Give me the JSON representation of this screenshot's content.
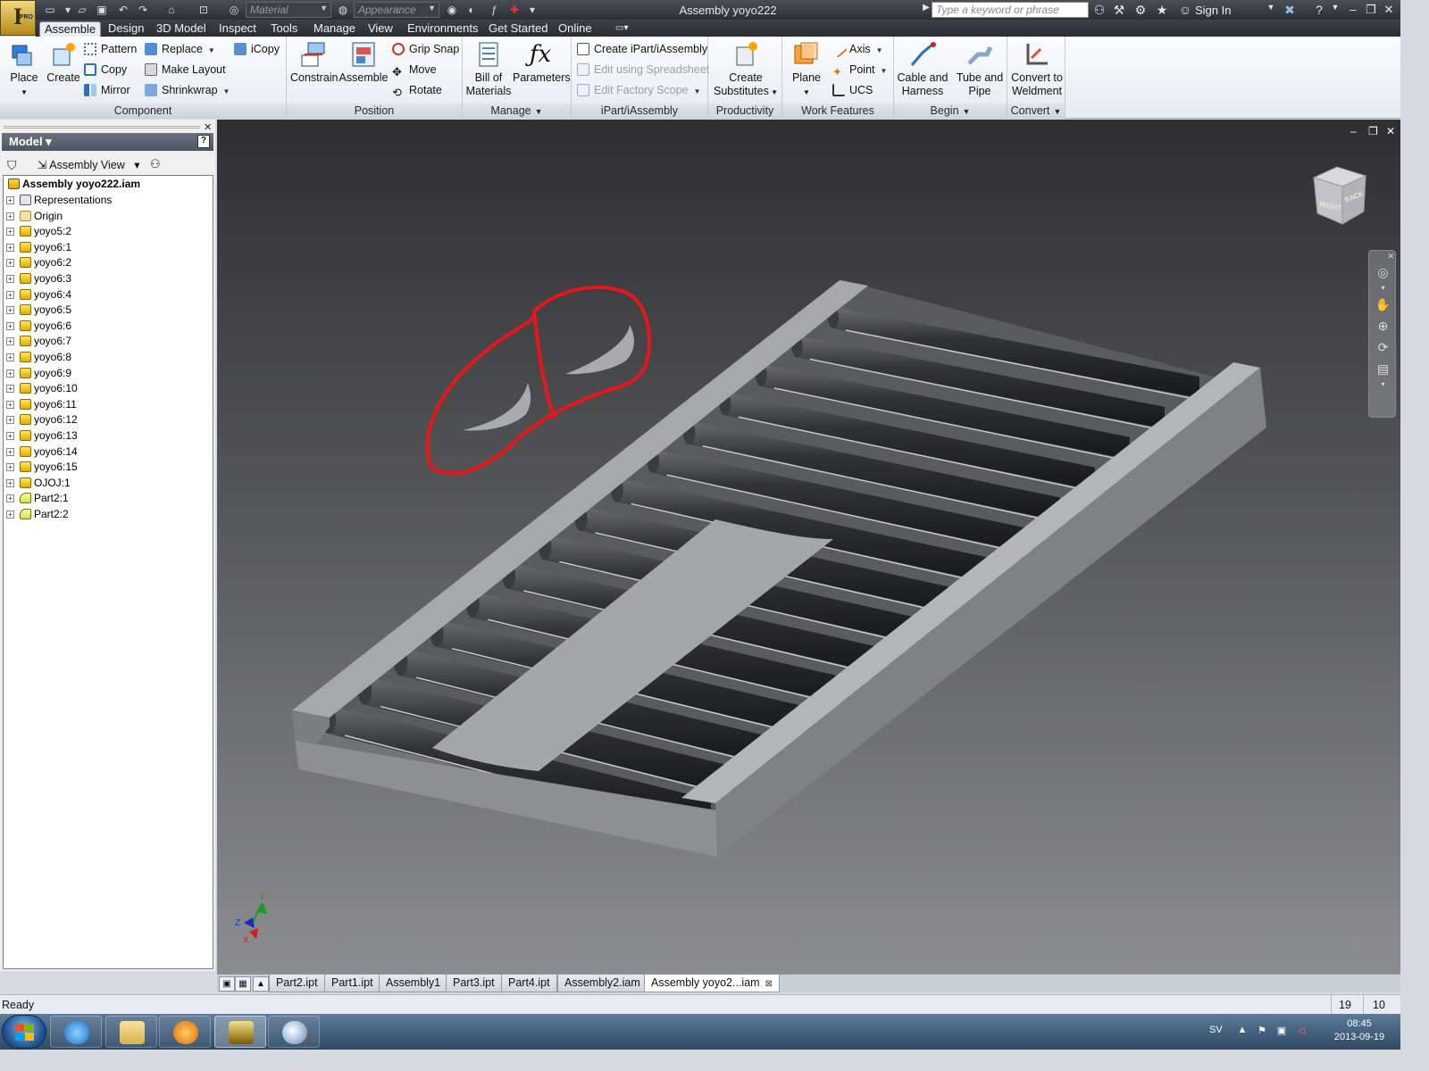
{
  "window": {
    "title": "Assembly yoyo222",
    "app_letter": "I",
    "app_badge": "PRO",
    "search_placeholder": "Type a keyword or phrase",
    "sign_in": "Sign In",
    "material_combo": "Material",
    "appearance_combo": "Appearance"
  },
  "menu_tabs": [
    "Assemble",
    "Design",
    "3D Model",
    "Inspect",
    "Tools",
    "Manage",
    "View",
    "Environments",
    "Get Started",
    "Online"
  ],
  "active_tab": "Assemble",
  "ribbon": {
    "component": {
      "title": "Component",
      "place": "Place",
      "create": "Create",
      "pattern": "Pattern",
      "copy": "Copy",
      "mirror": "Mirror",
      "replace": "Replace",
      "make_layout": "Make Layout",
      "shrinkwrap": "Shrinkwrap",
      "icopy": "iCopy"
    },
    "position": {
      "title": "Position",
      "constrain": "Constrain",
      "assemble": "Assemble",
      "grip_snap": "Grip Snap",
      "move": "Move",
      "rotate": "Rotate"
    },
    "manage": {
      "title": "Manage",
      "bom_line1": "Bill of",
      "bom_line2": "Materials",
      "parameters": "Parameters"
    },
    "ipart": {
      "title": "iPart/iAssembly",
      "create": "Create iPart/iAssembly",
      "edit_spreadsheet": "Edit using Spreadsheet",
      "edit_factory": "Edit Factory Scope"
    },
    "productivity": {
      "title": "Productivity",
      "line1": "Create",
      "line2": "Substitutes"
    },
    "work_features": {
      "title": "Work Features",
      "plane": "Plane",
      "axis": "Axis",
      "point": "Point",
      "ucs": "UCS"
    },
    "begin": {
      "title": "Begin",
      "cable_line1": "Cable and",
      "cable_line2": "Harness",
      "tube_line1": "Tube and",
      "tube_line2": "Pipe"
    },
    "convert": {
      "title": "Convert",
      "line1": "Convert to",
      "line2": "Weldment"
    }
  },
  "browser": {
    "title": "Model",
    "view": "Assembly View",
    "root": "Assembly yoyo222.iam",
    "nodes": [
      {
        "label": "Representations",
        "kind": "rep"
      },
      {
        "label": "Origin",
        "kind": "folder"
      },
      {
        "label": "yoyo5:2",
        "kind": "part"
      },
      {
        "label": "yoyo6:1",
        "kind": "part"
      },
      {
        "label": "yoyo6:2",
        "kind": "part"
      },
      {
        "label": "yoyo6:3",
        "kind": "part"
      },
      {
        "label": "yoyo6:4",
        "kind": "part"
      },
      {
        "label": "yoyo6:5",
        "kind": "part"
      },
      {
        "label": "yoyo6:6",
        "kind": "part"
      },
      {
        "label": "yoyo6:7",
        "kind": "part"
      },
      {
        "label": "yoyo6:8",
        "kind": "part"
      },
      {
        "label": "yoyo6:9",
        "kind": "part"
      },
      {
        "label": "yoyo6:10",
        "kind": "part"
      },
      {
        "label": "yoyo6:11",
        "kind": "part"
      },
      {
        "label": "yoyo6:12",
        "kind": "part"
      },
      {
        "label": "yoyo6:13",
        "kind": "part"
      },
      {
        "label": "yoyo6:14",
        "kind": "part"
      },
      {
        "label": "yoyo6:15",
        "kind": "part"
      },
      {
        "label": "OJOJ:1",
        "kind": "part"
      },
      {
        "label": "Part2:1",
        "kind": "p2"
      },
      {
        "label": "Part2:2",
        "kind": "p2"
      }
    ]
  },
  "viewcube": {
    "right": "RIGHT",
    "back": "BACK"
  },
  "triad": {
    "x": "X",
    "y": "Y",
    "z": "Z"
  },
  "doc_tabs": [
    "Part2.ipt",
    "Part1.ipt",
    "Assembly1",
    "Part3.ipt",
    "Part4.ipt",
    "Assembly2.iam",
    "Assembly yoyo2...iam"
  ],
  "active_doc_tab": "Assembly yoyo2...iam",
  "status": {
    "text": "Ready",
    "num1": "19",
    "num2": "10"
  },
  "taskbar": {
    "lang": "SV",
    "time": "08:45",
    "date": "2013-09-19"
  },
  "colors": {
    "annotation": "#e8151b",
    "roller": "#2a2b2d",
    "frame": "#8e8f91"
  }
}
